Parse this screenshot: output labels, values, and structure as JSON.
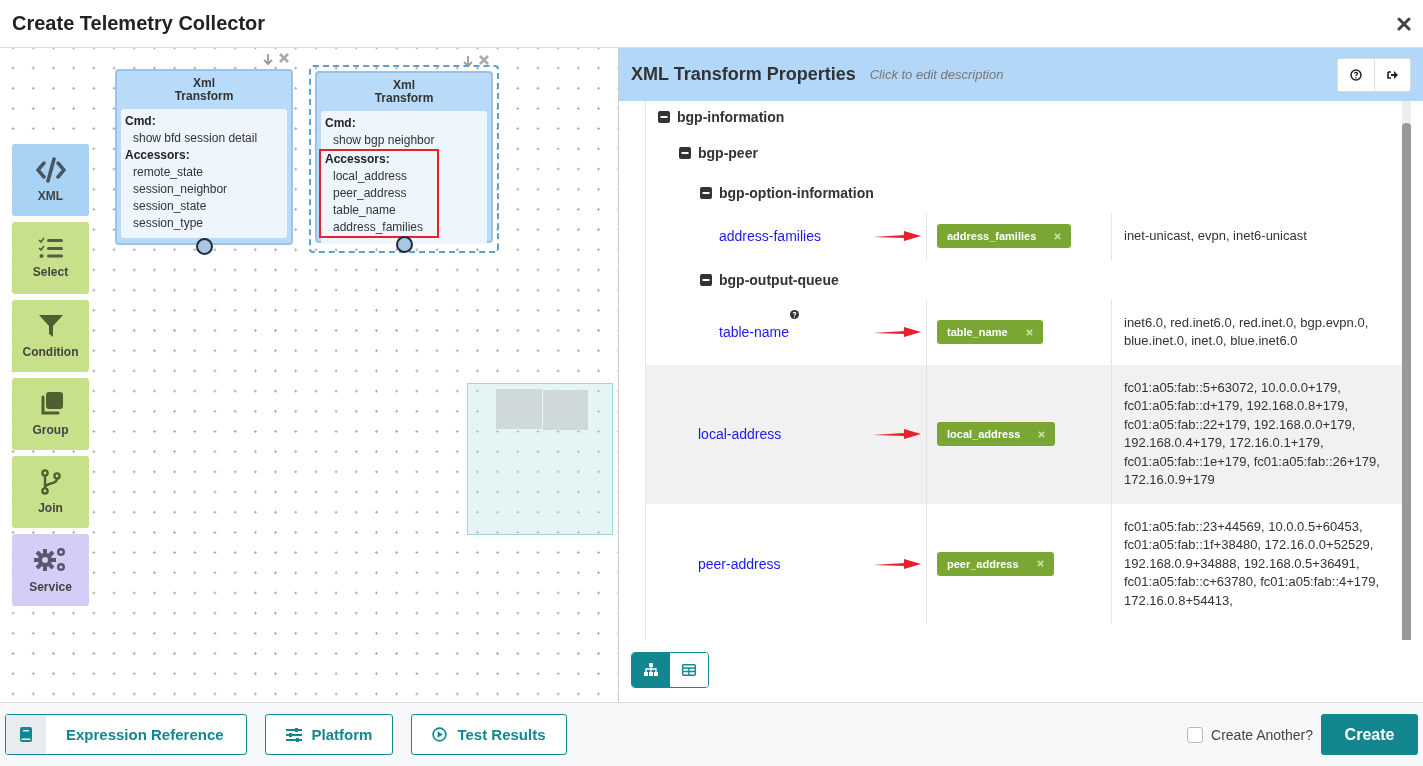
{
  "window": {
    "title": "Create Telemetry Collector"
  },
  "palette": [
    {
      "label": "XML",
      "kind": "xml"
    },
    {
      "label": "Select",
      "kind": "select"
    },
    {
      "label": "Condition",
      "kind": "condition"
    },
    {
      "label": "Group",
      "kind": "group"
    },
    {
      "label": "Join",
      "kind": "join"
    },
    {
      "label": "Service",
      "kind": "service"
    }
  ],
  "nodes": [
    {
      "title": "Xml Transform",
      "cmd_label": "Cmd:",
      "cmd": "show bfd session detail",
      "accessors_label": "Accessors:",
      "accessors": [
        "remote_state",
        "session_neighbor",
        "session_state",
        "session_type"
      ],
      "selected": false,
      "annotated": false
    },
    {
      "title": "Xml Transform",
      "cmd_label": "Cmd:",
      "cmd": "show bgp neighbor",
      "accessors_label": "Accessors:",
      "accessors": [
        "local_address",
        "peer_address",
        "table_name",
        "address_families"
      ],
      "selected": true,
      "annotated": true
    }
  ],
  "properties": {
    "title": "XML Transform Properties",
    "description": "Click to edit description",
    "tree": [
      {
        "kind": "group",
        "label": "bgp-information",
        "expanded": true,
        "children": [
          {
            "kind": "group",
            "label": "bgp-peer",
            "expanded": true,
            "children": [
              {
                "kind": "group",
                "label": "bgp-option-information",
                "expanded": true,
                "children": [
                  {
                    "kind": "field",
                    "name": "address-families",
                    "help": false,
                    "arrow": true,
                    "tag": "address_families",
                    "value": "inet-unicast, evpn, inet6-unicast",
                    "highlighted": false
                  }
                ]
              },
              {
                "kind": "group",
                "label": "bgp-output-queue",
                "expanded": true,
                "children": [
                  {
                    "kind": "field",
                    "name": "table-name",
                    "help": true,
                    "arrow": true,
                    "tag": "table_name",
                    "value": "inet6.0, red.inet6.0, red.inet.0, bgp.evpn.0, blue.inet.0, inet.0, blue.inet6.0",
                    "highlighted": false
                  }
                ]
              },
              {
                "kind": "field",
                "name": "local-address",
                "help": false,
                "arrow": true,
                "tag": "local_address",
                "value": "fc01:a05:fab::5+63072, 10.0.0.0+179, fc01:a05:fab::d+179, 192.168.0.8+179, fc01:a05:fab::22+179, 192.168.0.0+179, 192.168.0.4+179, 172.16.0.1+179, fc01:a05:fab::1e+179, fc01:a05:fab::26+179, 172.16.0.9+179",
                "highlighted": true
              },
              {
                "kind": "field",
                "name": "peer-address",
                "help": false,
                "arrow": true,
                "tag": "peer_address",
                "value": "fc01:a05:fab::23+44569, 10.0.0.5+60453, fc01:a05:fab::1f+38480, 172.16.0.0+52529, 192.168.0.9+34888, 192.168.0.5+36491, fc01:a05:fab::c+63780, fc01:a05:fab::4+179, 172.16.0.8+54413,",
                "highlighted": false
              }
            ]
          }
        ]
      }
    ]
  },
  "view_toggle": [
    {
      "kind": "tree",
      "selected": true
    },
    {
      "kind": "table",
      "selected": false
    }
  ],
  "footer": {
    "buttons": [
      {
        "label": "Expression Reference",
        "kind": "book"
      },
      {
        "label": "Platform",
        "kind": "sliders"
      },
      {
        "label": "Test Results",
        "kind": "play"
      }
    ],
    "create_another": {
      "label": "Create Another?",
      "checked": false
    },
    "primary": "Create"
  }
}
